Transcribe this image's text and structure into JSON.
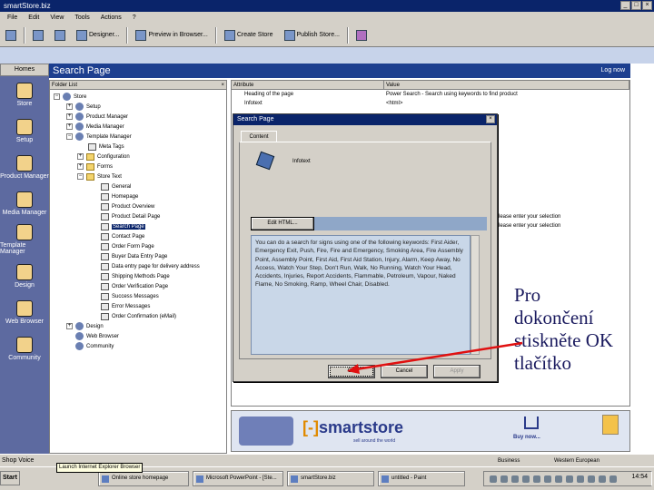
{
  "window": {
    "title": "smartStore.biz"
  },
  "menu": [
    "File",
    "Edit",
    "View",
    "Tools",
    "Actions",
    "?"
  ],
  "toolbar": {
    "designer": "Designer...",
    "preview": "Preview in Browser...",
    "create": "Create Store",
    "publish": "Publish Store..."
  },
  "outlook_bar": {
    "header": "Homes",
    "items": [
      "Store",
      "Setup",
      "Product Manager",
      "Media Manager",
      "Template Manager",
      "Design",
      "Web Browser",
      "Community"
    ]
  },
  "page": {
    "title": "Search Page",
    "logout": "Log now"
  },
  "tree": {
    "header": "Folder List",
    "nodes": [
      "Store",
      "Setup",
      "Product Manager",
      "Media Manager",
      "Template Manager",
      "Meta Tags",
      "Configuration",
      "Forms",
      "Store Text",
      "General",
      "Homepage",
      "Product Overview",
      "Product Detail Page",
      "Search Page",
      "Contact Page",
      "Order Form Page",
      "Buyer Data Entry Page",
      "Data entry page for delivery address",
      "Shipping Methods Page",
      "Order Verification Page",
      "Success Messages",
      "Error Messages",
      "Order Confirmation (eMail)",
      "Design",
      "Web Browser",
      "Community"
    ]
  },
  "attributes": {
    "header_attr": "Attribute",
    "header_value": "Value",
    "rows": [
      {
        "attr": "Heading of the page",
        "value": "Power Search - Search using keywords to find product"
      },
      {
        "attr": "Infotext",
        "value": "<html>"
      }
    ],
    "extra": [
      "Please enter your selection",
      "Please enter your selection"
    ]
  },
  "dialog": {
    "title": "Search Page",
    "tab": "Content",
    "name": "Infotext",
    "edit_button": "Edit HTML...",
    "text": "You can do a search for signs using one of the following keywords: First Aider, Emergency Exit, Push, Fire, Fire and Emergency, Smoking Area, Fire Assembly Point, Assembly Point, First Aid, First Aid Station, Injury, Alarm, Keep Away, No Access, Watch Your Step, Don't Run, Walk, No Running, Watch Your Head, Accidents, Injuries, Report Accidents, Flammable, Petroleum, Vapour, Naked Flame, No Smoking, Ramp, Wheel Chair, Disabled.",
    "ok": "OK",
    "cancel": "Cancel",
    "apply": "Apply"
  },
  "banner": {
    "logo_prefix": "[-]",
    "logo": "smartstore",
    "tagline": "sell around the world",
    "buy": "Buy now..."
  },
  "status": {
    "left": "Shop Voice",
    "zone": "Business",
    "lang": "Western European",
    "tooltip": "Launch Internet Explorer Browser"
  },
  "taskbar": {
    "start": "Start",
    "buttons": [
      "Online store homepage",
      "Microsoft PowerPoint - [Ste...",
      "smartStore.biz",
      "untitled - Paint"
    ],
    "clock": "14:54"
  },
  "annotation": {
    "lines": [
      "Pro",
      "dokončení",
      "stiskněte OK",
      "tlačítko"
    ],
    "arrow_color": "#e01010"
  }
}
